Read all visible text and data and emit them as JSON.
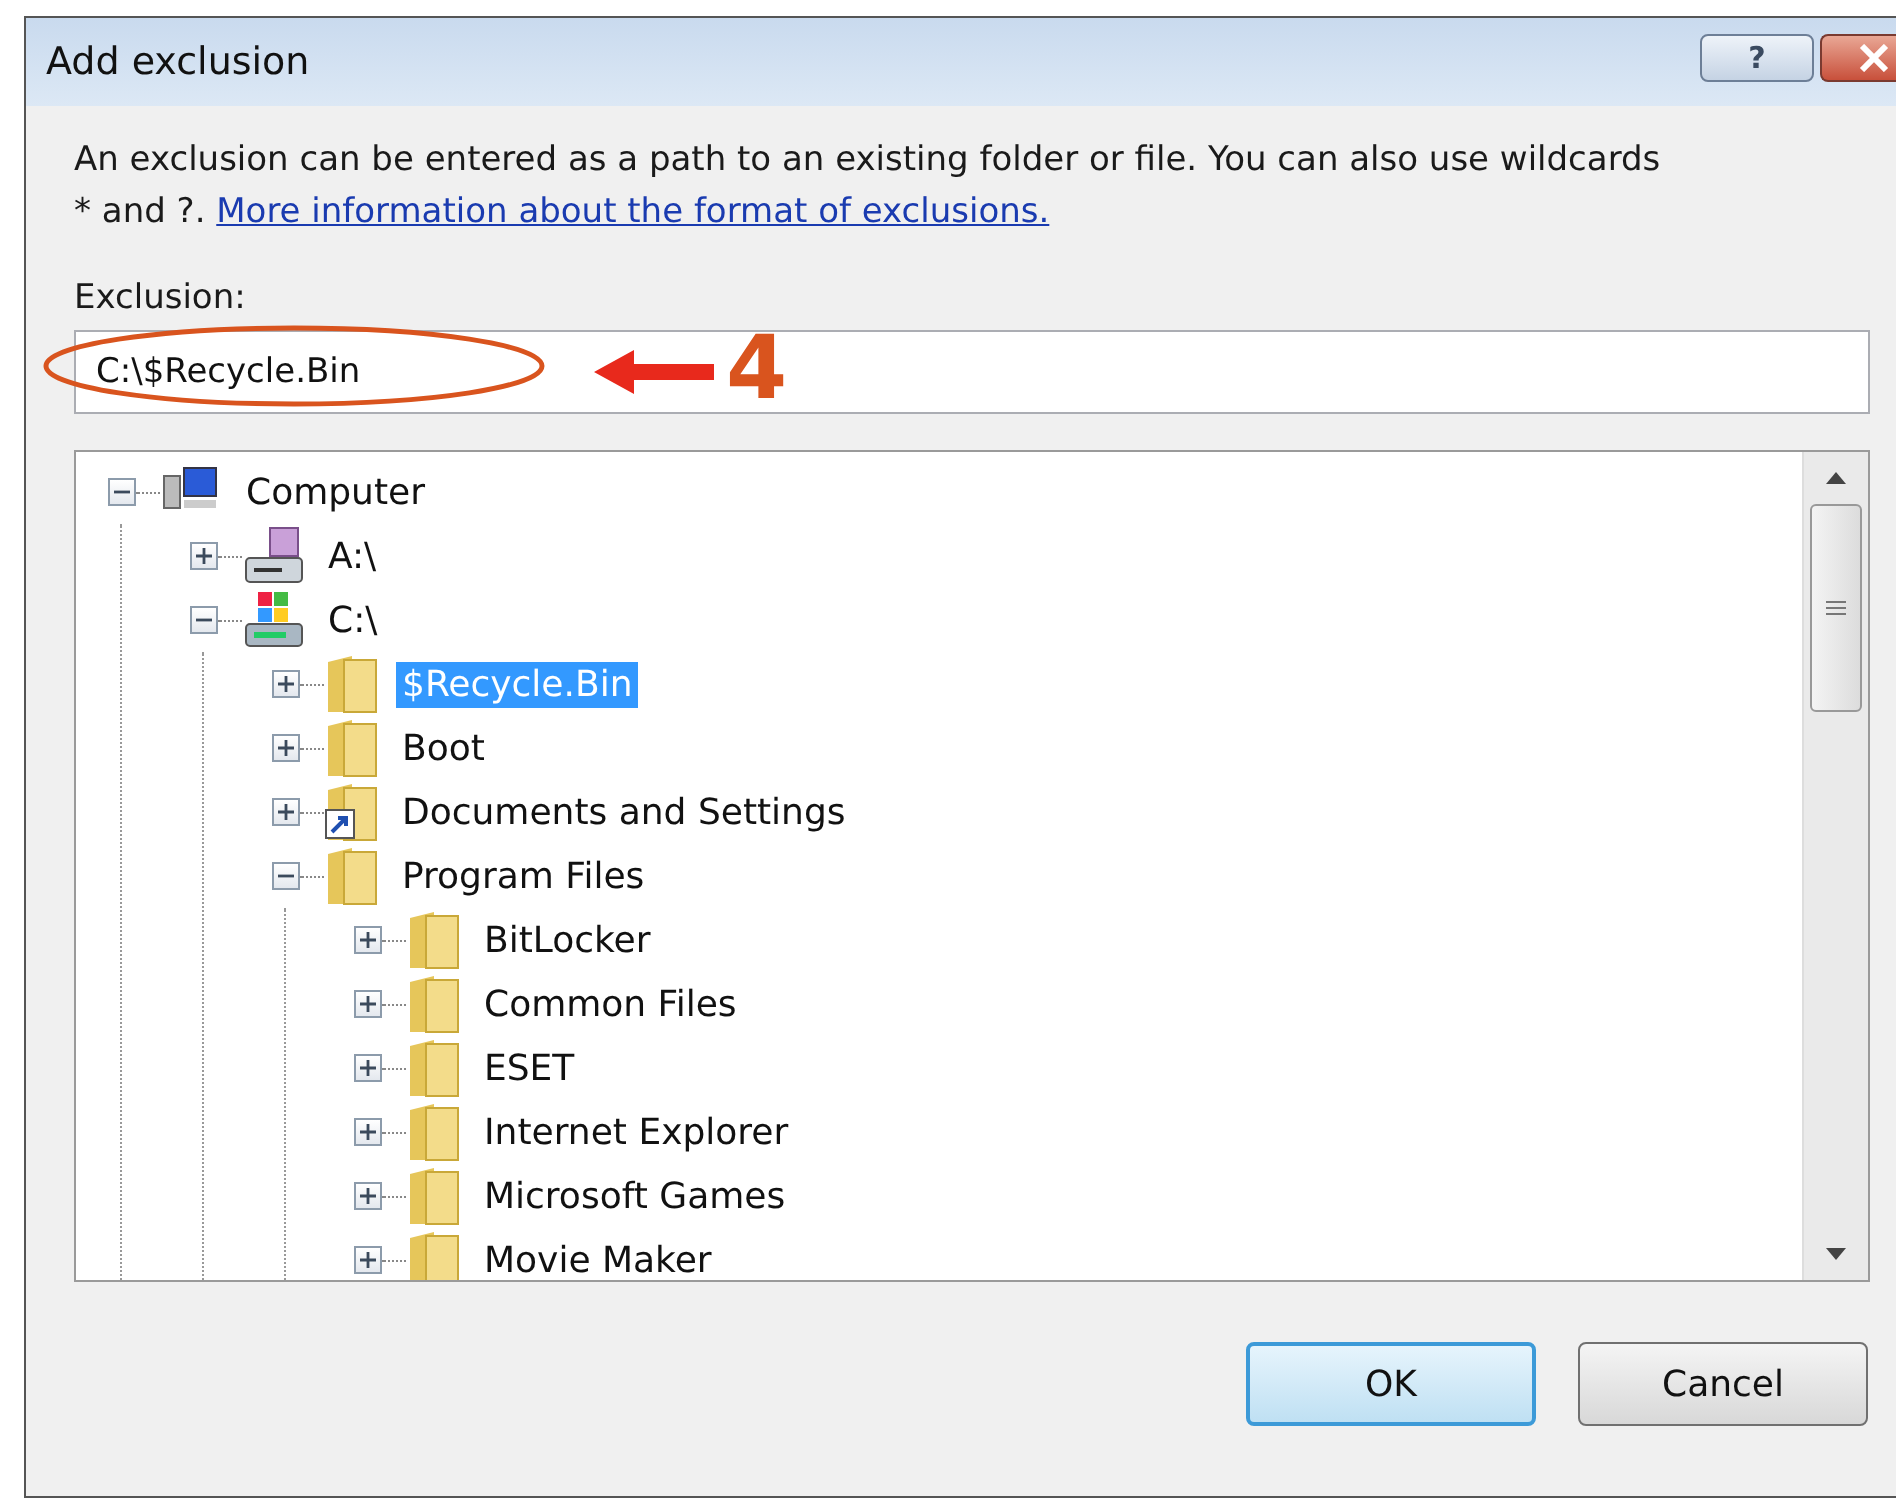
{
  "window": {
    "title": "Add exclusion",
    "help_button": "?"
  },
  "description": {
    "text": "An exclusion can be entered as a path to an existing folder or file. You can also use wildcards * and ?.",
    "link": "More information about the format of exclusions."
  },
  "exclusion_field": {
    "label": "Exclusion:",
    "value": "C:\\$Recycle.Bin"
  },
  "annotation": {
    "label": "4"
  },
  "tree": [
    {
      "label": "Computer",
      "kind": "computer",
      "expanded": true,
      "selected": false,
      "children": [
        {
          "label": "A:\\",
          "kind": "floppy",
          "expanded": false,
          "selected": false
        },
        {
          "label": "C:\\",
          "kind": "drive",
          "expanded": true,
          "selected": false,
          "children": [
            {
              "label": "$Recycle.Bin",
              "kind": "folder",
              "expanded": false,
              "selected": true
            },
            {
              "label": "Boot",
              "kind": "folder",
              "expanded": false,
              "selected": false
            },
            {
              "label": "Documents and Settings",
              "kind": "shortcut",
              "expanded": false,
              "selected": false
            },
            {
              "label": "Program Files",
              "kind": "folder",
              "expanded": true,
              "selected": false,
              "children": [
                {
                  "label": "BitLocker",
                  "kind": "folder",
                  "expanded": false,
                  "selected": false
                },
                {
                  "label": "Common Files",
                  "kind": "folder",
                  "expanded": false,
                  "selected": false
                },
                {
                  "label": "ESET",
                  "kind": "folder",
                  "expanded": false,
                  "selected": false
                },
                {
                  "label": "Internet Explorer",
                  "kind": "folder",
                  "expanded": false,
                  "selected": false
                },
                {
                  "label": "Microsoft Games",
                  "kind": "folder",
                  "expanded": false,
                  "selected": false
                },
                {
                  "label": "Movie Maker",
                  "kind": "folder",
                  "expanded": false,
                  "selected": false
                }
              ]
            }
          ]
        }
      ]
    }
  ],
  "buttons": [
    {
      "label": "OK",
      "selected": true
    },
    {
      "label": "Cancel",
      "selected": false
    }
  ]
}
